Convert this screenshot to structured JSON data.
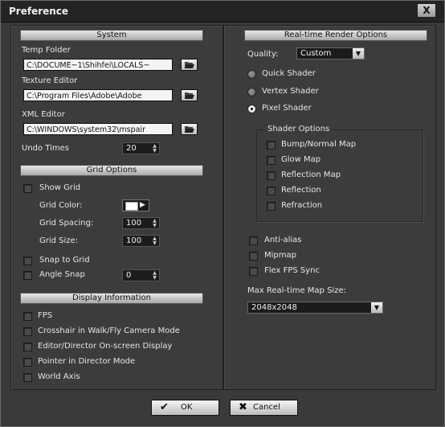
{
  "window": {
    "title": "Preference",
    "close_label": "X"
  },
  "system": {
    "header": "System",
    "temp_folder_label": "Temp Folder",
    "temp_folder_value": "C:\\DOCUME~1\\Shihfei\\LOCALS~",
    "texture_editor_label": "Texture Editor",
    "texture_editor_value": "C:\\Program Files\\Adobe\\Adobe",
    "xml_editor_label": "XML Editor",
    "xml_editor_value": "C:\\WINDOWS\\system32\\mspair",
    "undo_times_label": "Undo Times",
    "undo_times_value": "20"
  },
  "grid_options": {
    "header": "Grid Options",
    "show_grid_label": "Show Grid",
    "grid_color_label": "Grid Color:",
    "grid_spacing_label": "Grid Spacing:",
    "grid_spacing_value": "100",
    "grid_size_label": "Grid Size:",
    "grid_size_value": "100",
    "snap_to_grid_label": "Snap to Grid",
    "angle_snap_label": "Angle Snap",
    "angle_snap_value": "0"
  },
  "display_info": {
    "header": "Display Information",
    "items": [
      "FPS",
      "Crosshair in Walk/Fly Camera Mode",
      "Editor/Director On-screen Display",
      "Pointer in Director Mode",
      "World Axis"
    ]
  },
  "render": {
    "header": "Real-time Render Options",
    "quality_label": "Quality:",
    "quality_value": "Custom",
    "shaders": [
      "Quick Shader",
      "Vertex Shader",
      "Pixel Shader"
    ],
    "selected_shader": "Pixel Shader",
    "shader_options_title": "Shader Options",
    "shader_options": [
      "Bump/Normal Map",
      "Glow Map",
      "Reflection Map",
      "Reflection",
      "Refraction"
    ],
    "extra_options": [
      "Anti-alias",
      "Mipmap",
      "Flex FPS Sync"
    ],
    "max_map_size_label": "Max Real-time Map Size:",
    "max_map_size_value": "2048x2048"
  },
  "buttons": {
    "ok_label": "OK",
    "cancel_label": "Cancel"
  }
}
